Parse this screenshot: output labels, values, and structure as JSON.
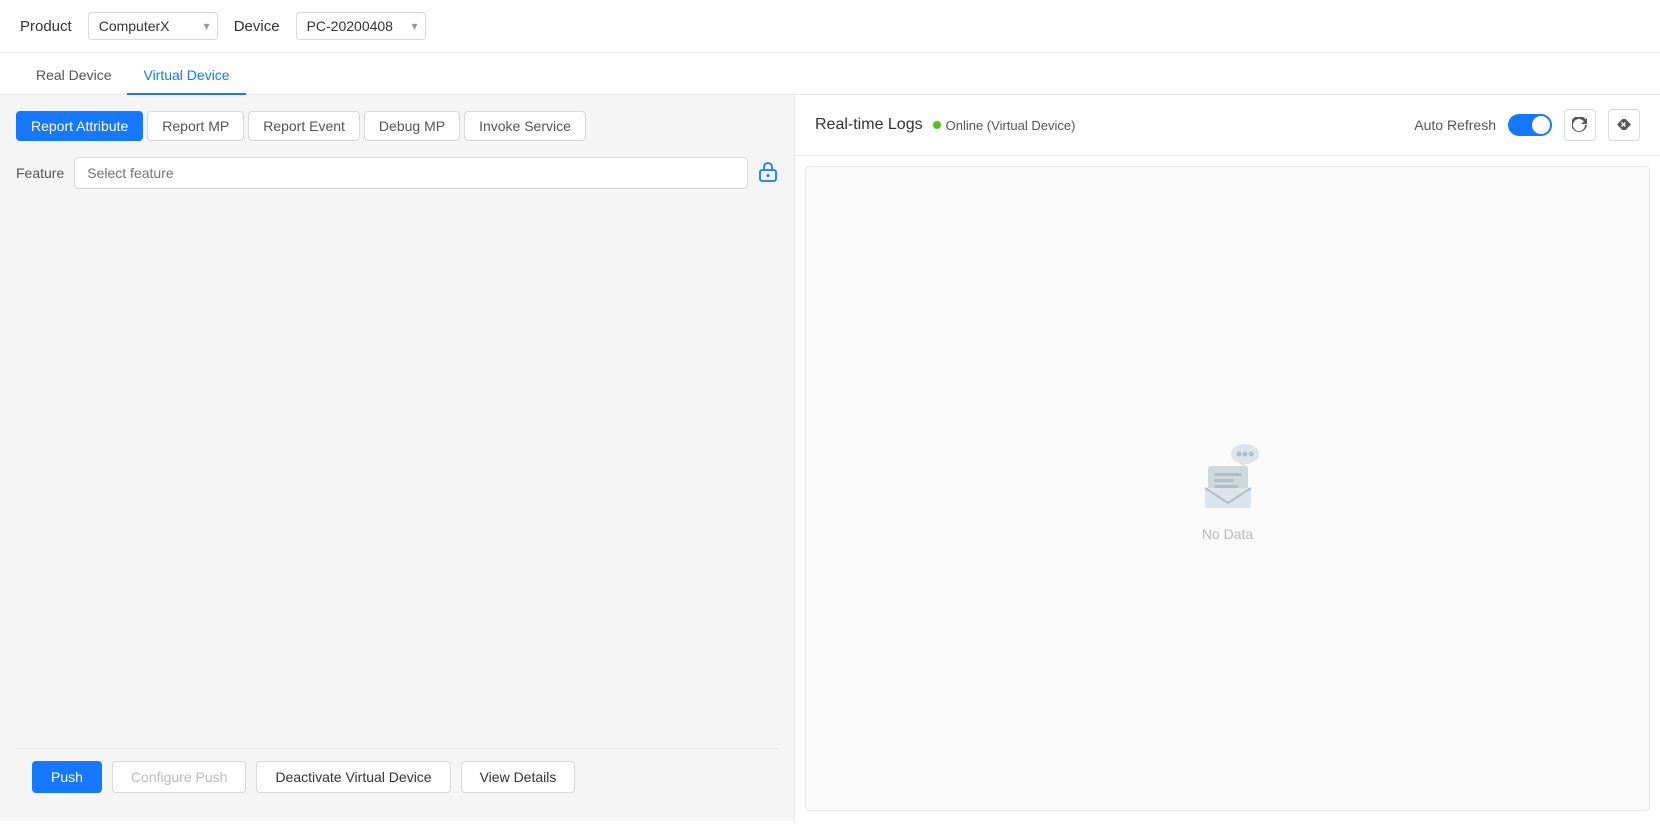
{
  "topbar": {
    "product_label": "Product",
    "device_label": "Device",
    "product_value": "ComputerX",
    "device_value": "PC-20200408",
    "product_options": [
      "ComputerX"
    ],
    "device_options": [
      "PC-20200408"
    ]
  },
  "device_tabs": {
    "items": [
      {
        "id": "real-device",
        "label": "Real Device",
        "active": false
      },
      {
        "id": "virtual-device",
        "label": "Virtual Device",
        "active": true
      }
    ]
  },
  "sub_tabs": {
    "items": [
      {
        "id": "report-attribute",
        "label": "Report Attribute",
        "active": true
      },
      {
        "id": "report-mp",
        "label": "Report MP",
        "active": false
      },
      {
        "id": "report-event",
        "label": "Report Event",
        "active": false
      },
      {
        "id": "debug-mp",
        "label": "Debug MP",
        "active": false
      },
      {
        "id": "invoke-service",
        "label": "Invoke Service",
        "active": false
      }
    ]
  },
  "feature": {
    "label": "Feature",
    "placeholder": "Select feature"
  },
  "bottom_bar": {
    "push_label": "Push",
    "configure_push_label": "Configure Push",
    "deactivate_label": "Deactivate Virtual Device",
    "view_details_label": "View Details"
  },
  "right_panel": {
    "title": "Real-time Logs",
    "status_label": "Online (Virtual Device)",
    "auto_refresh_label": "Auto Refresh",
    "no_data_text": "No Data",
    "refresh_icon": "↻",
    "clear_icon": "⌫"
  },
  "colors": {
    "primary": "#1677ff",
    "online": "#52c41a",
    "text_secondary": "#555",
    "border": "#d9d9d9"
  }
}
